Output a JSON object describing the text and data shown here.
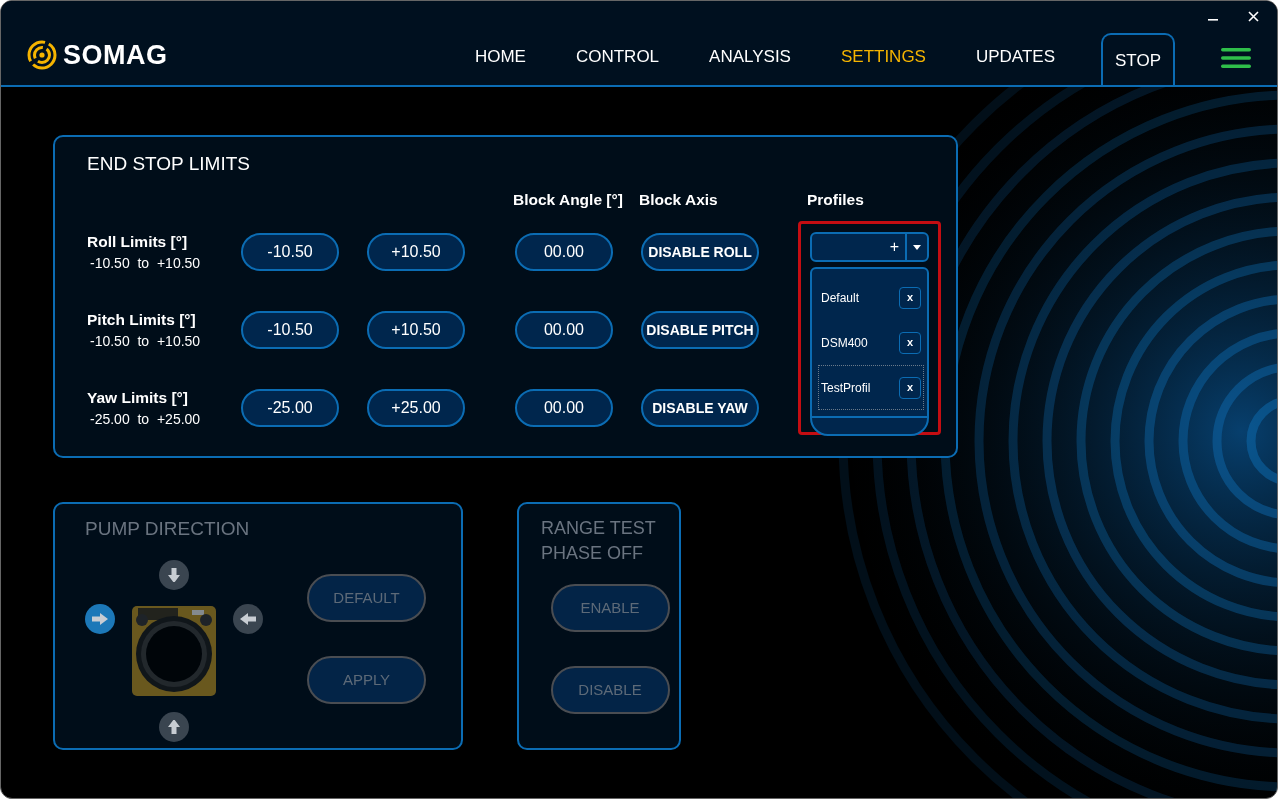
{
  "brand": {
    "name": "SOMAG"
  },
  "nav": [
    {
      "label": "HOME",
      "kind": "link",
      "selected": false
    },
    {
      "label": "CONTROL",
      "kind": "link",
      "selected": false
    },
    {
      "label": "ANALYSIS",
      "kind": "link",
      "selected": false
    },
    {
      "label": "SETTINGS",
      "kind": "link",
      "selected": true
    },
    {
      "label": "UPDATES",
      "kind": "link",
      "selected": false
    },
    {
      "label": "STOP",
      "kind": "boxed",
      "selected": false
    }
  ],
  "end_stop_limits": {
    "title": "END STOP LIMITS",
    "headers": [
      "Block Angle [°]",
      "Block Axis",
      "Profiles"
    ],
    "rows": [
      {
        "label": "Roll Limits [°]",
        "min": "-10.50",
        "to": "to",
        "max": "+10.50",
        "min_button": "-10.50",
        "max_button": "+10.50",
        "angle": "00.00",
        "block_button": "DISABLE ROLL"
      },
      {
        "label": "Pitch Limits [°]",
        "min": "-10.50",
        "to": "to",
        "max": "+10.50",
        "min_button": "-10.50",
        "max_button": "+10.50",
        "angle": "00.00",
        "block_button": "DISABLE PITCH"
      },
      {
        "label": "Yaw Limits [°]",
        "min": "-25.00",
        "to": "to",
        "max": "+25.00",
        "min_button": "-25.00",
        "max_button": "+25.00",
        "angle": "00.00",
        "block_button": "DISABLE YAW"
      }
    ],
    "profiles": {
      "highlighted": true,
      "add_label": "+",
      "expanded": true,
      "items": [
        {
          "name": "Default",
          "remove": "x",
          "focused": false
        },
        {
          "name": "DSM400",
          "remove": "x",
          "focused": false
        },
        {
          "name": "TestProfil",
          "remove": "x",
          "focused": true
        }
      ]
    }
  },
  "pump_direction": {
    "title": "PUMP DIRECTION",
    "disabled": true,
    "arrows": [
      {
        "kind": "down",
        "selected": false
      },
      {
        "kind": "right",
        "selected": true
      },
      {
        "kind": "left",
        "selected": false
      },
      {
        "kind": "up",
        "selected": false
      }
    ],
    "buttons": [
      "DEFAULT",
      "APPLY"
    ]
  },
  "range_test": {
    "title": "RANGE TEST PHASE OFF",
    "disabled": true,
    "buttons": [
      "ENABLE",
      "DISABLE"
    ]
  }
}
